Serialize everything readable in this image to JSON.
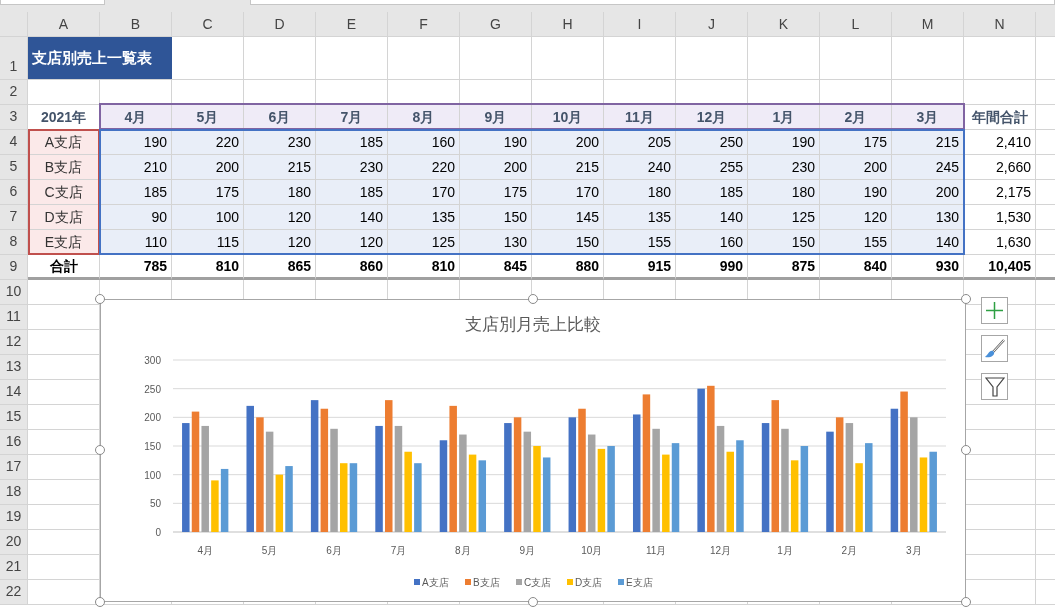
{
  "column_headers": [
    "A",
    "B",
    "C",
    "D",
    "E",
    "F",
    "G",
    "H",
    "I",
    "J",
    "K",
    "L",
    "M",
    "N"
  ],
  "row_headers": [
    "1",
    "2",
    "3",
    "4",
    "5",
    "6",
    "7",
    "8",
    "9",
    "10",
    "11",
    "12",
    "13",
    "14",
    "15",
    "16",
    "17",
    "18",
    "19",
    "20",
    "21",
    "22"
  ],
  "sheet_title": "支店別売上一覧表",
  "table": {
    "corner": "2021年",
    "months": [
      "4月",
      "5月",
      "6月",
      "7月",
      "8月",
      "9月",
      "10月",
      "11月",
      "12月",
      "1月",
      "2月",
      "3月"
    ],
    "total_label": "年間合計",
    "rows": [
      {
        "branch": "A支店",
        "values": [
          "190",
          "220",
          "230",
          "185",
          "160",
          "190",
          "200",
          "205",
          "250",
          "190",
          "175",
          "215"
        ],
        "total": "2,410"
      },
      {
        "branch": "B支店",
        "values": [
          "210",
          "200",
          "215",
          "230",
          "220",
          "200",
          "215",
          "240",
          "255",
          "230",
          "200",
          "245"
        ],
        "total": "2,660"
      },
      {
        "branch": "C支店",
        "values": [
          "185",
          "175",
          "180",
          "185",
          "170",
          "175",
          "170",
          "180",
          "185",
          "180",
          "190",
          "200"
        ],
        "total": "2,175"
      },
      {
        "branch": "D支店",
        "values": [
          "90",
          "100",
          "120",
          "140",
          "135",
          "150",
          "145",
          "135",
          "140",
          "125",
          "120",
          "130"
        ],
        "total": "1,530"
      },
      {
        "branch": "E支店",
        "values": [
          "110",
          "115",
          "120",
          "120",
          "125",
          "130",
          "150",
          "155",
          "160",
          "150",
          "155",
          "140"
        ],
        "total": "1,630"
      }
    ],
    "totals": {
      "label": "合計",
      "values": [
        "785",
        "810",
        "865",
        "860",
        "810",
        "845",
        "880",
        "915",
        "990",
        "875",
        "840",
        "930"
      ],
      "total": "10,405"
    }
  },
  "chart": {
    "chart_data": {
      "type": "bar",
      "title": "支店別月売上比較",
      "categories": [
        "4月",
        "5月",
        "6月",
        "7月",
        "8月",
        "9月",
        "10月",
        "11月",
        "12月",
        "1月",
        "2月",
        "3月"
      ],
      "series": [
        {
          "name": "A支店",
          "color": "#4472c4",
          "values": [
            190,
            220,
            230,
            185,
            160,
            190,
            200,
            205,
            250,
            190,
            175,
            215
          ]
        },
        {
          "name": "B支店",
          "color": "#ed7d31",
          "values": [
            210,
            200,
            215,
            230,
            220,
            200,
            215,
            240,
            255,
            230,
            200,
            245
          ]
        },
        {
          "name": "C支店",
          "color": "#a5a5a5",
          "values": [
            185,
            175,
            180,
            185,
            170,
            175,
            170,
            180,
            185,
            180,
            190,
            200
          ]
        },
        {
          "name": "D支店",
          "color": "#ffc000",
          "values": [
            90,
            100,
            120,
            140,
            135,
            150,
            145,
            135,
            140,
            125,
            120,
            130
          ]
        },
        {
          "name": "E支店",
          "color": "#5b9bd5",
          "values": [
            110,
            115,
            120,
            120,
            125,
            130,
            150,
            155,
            160,
            150,
            155,
            140
          ]
        }
      ],
      "grid": true,
      "legend": true,
      "ylim": [
        0,
        300
      ],
      "yticks": [
        0,
        50,
        100,
        150,
        200,
        250,
        300
      ]
    }
  }
}
